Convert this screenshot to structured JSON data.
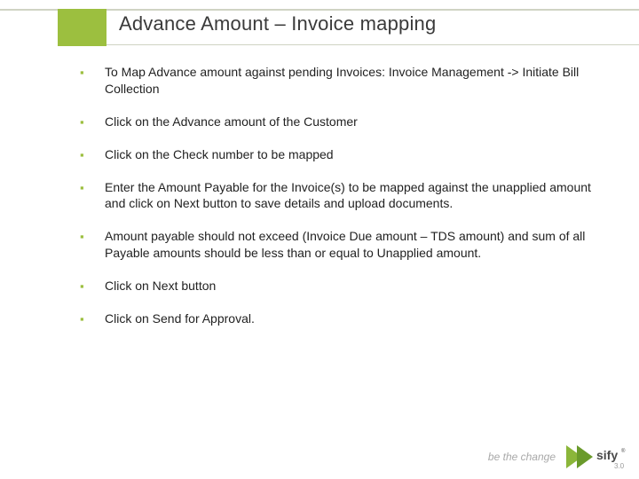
{
  "title": "Advance Amount – Invoice mapping",
  "bullets": [
    "To Map Advance amount against pending Invoices: Invoice Management -> Initiate Bill Collection",
    "Click on the Advance amount of the Customer",
    "Click on the Check number to be mapped",
    "Enter the Amount Payable for the Invoice(s) to be mapped against the unapplied amount and click on Next button to save details and upload documents.",
    "Amount payable should not exceed (Invoice Due amount – TDS amount) and sum of all Payable amounts should be less than or equal to Unapplied amount.",
    "Click on Next button",
    "Click on Send for Approval."
  ],
  "footer": {
    "tagline": "be the change"
  }
}
